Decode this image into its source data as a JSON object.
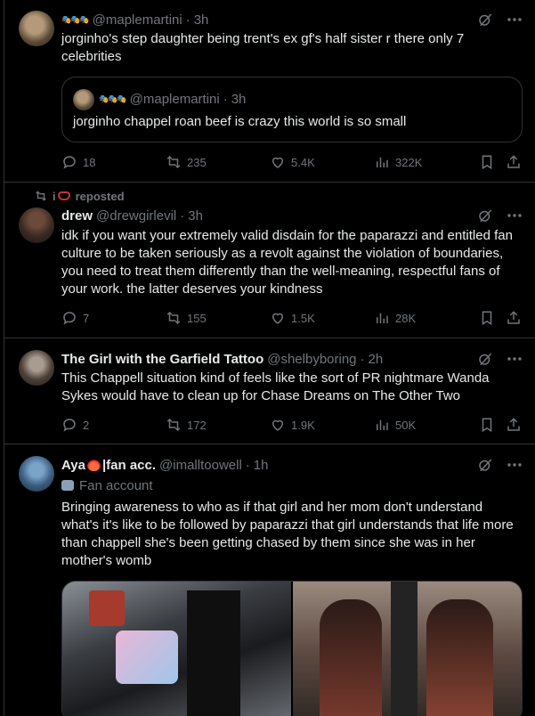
{
  "posts": [
    {
      "badge": "🎭🎭🎭",
      "handle": "@maplemartini",
      "time": "3h",
      "text": "jorginho's step daughter being trent's ex gf's half sister r there only 7 celebrities",
      "quote": {
        "badge": "🎭🎭🎭",
        "handle": "@maplemartini",
        "time": "3h",
        "text": "jorginho chappel roan beef is crazy this world is so small"
      },
      "replies": "18",
      "reposts": "235",
      "likes": "5.4K",
      "views": "322K"
    },
    {
      "repost_by": "i",
      "repost_label": "reposted",
      "name": "drew",
      "handle": "@drewgirlevil",
      "time": "3h",
      "text": "idk if you want your extremely valid disdain for the paparazzi and entitled fan culture to be taken seriously as a revolt against the violation of boundaries, you need to treat them differently than the well-meaning, respectful fans of your work. the latter deserves your kindness",
      "replies": "7",
      "reposts": "155",
      "likes": "1.5K",
      "views": "28K"
    },
    {
      "name": "The Girl with the Garfield Tattoo",
      "handle": "@shelbyboring",
      "time": "2h",
      "text": "This Chappell situation kind of feels like the sort of PR nightmare Wanda Sykes would have to clean up for Chase Dreams on The Other Two",
      "replies": "2",
      "reposts": "172",
      "likes": "1.9K",
      "views": "50K"
    },
    {
      "name_prefix": "Aya",
      "name_suffix": "|fan acc.",
      "handle": "@imalltoowell",
      "time": "1h",
      "label": "Fan account",
      "text": "Bringing awareness to who as if that girl and her mom don't understand what's it's like to be followed by paparazzi that girl understands that life more than chappell she's been getting chased by them since she was in her mother's womb"
    }
  ],
  "colors": {
    "bg": "#000000",
    "border": "#2f3336",
    "muted": "#71767b",
    "text": "#e7e9ea"
  }
}
